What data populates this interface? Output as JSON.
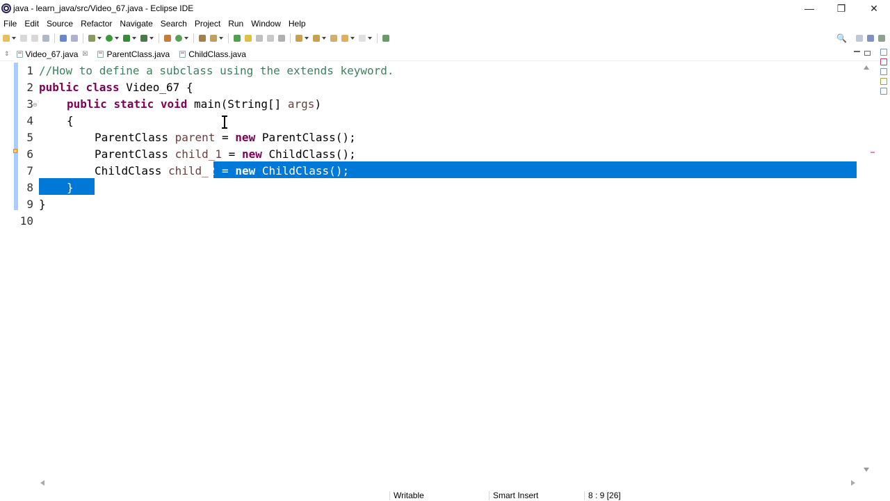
{
  "window": {
    "title": "java - learn_java/src/Video_67.java - Eclipse IDE",
    "min_glyph": "—",
    "max_glyph": "❐",
    "close_glyph": "✕"
  },
  "menu": [
    "File",
    "Edit",
    "Source",
    "Refactor",
    "Navigate",
    "Search",
    "Project",
    "Run",
    "Window",
    "Help"
  ],
  "tabs": [
    {
      "label": "Video_67.java",
      "active": true,
      "close": "☒"
    },
    {
      "label": "ParentClass.java",
      "active": false
    },
    {
      "label": "ChildClass.java",
      "active": false
    }
  ],
  "editor": {
    "line_numbers": [
      "1",
      "2",
      "3",
      "4",
      "5",
      "6",
      "7",
      "8",
      "9",
      "10"
    ],
    "line1": {
      "comment": "//How to define a subclass using the extends keyword."
    },
    "line2": {
      "kw1": "public",
      "kw2": "class",
      "rest": " Video_67 {"
    },
    "line3": {
      "kw1": "public",
      "kw2": "static",
      "kw3": "void",
      "rest1": " main(String[] ",
      "var": "args",
      "rest2": ")"
    },
    "line4": {
      "text": "{"
    },
    "line5": {
      "type": "ParentClass ",
      "var": "parent",
      "eq": " = ",
      "kw": "new",
      "rest": " ParentClass();"
    },
    "line6": {
      "type": "ParentClass ",
      "var": "child_1",
      "eq": " = ",
      "kw": "new",
      "rest": " ChildClass();"
    },
    "line7": {
      "type": "ChildClass ",
      "var_a": "child_",
      "var_b": "2",
      "eq": " = ",
      "kw": "new",
      "rest": " ChildClass();"
    },
    "line8": {
      "text": "}"
    },
    "line9": {
      "text": "}"
    },
    "fold_glyph": "⊖"
  },
  "status": {
    "writable": "Writable",
    "insert_mode": "Smart Insert",
    "position": "8 : 9 [26]"
  },
  "colors": {
    "selection": "#0078d7",
    "keyword": "#7f0055",
    "comment": "#3f7f5f",
    "variable": "#6a3e3e"
  }
}
